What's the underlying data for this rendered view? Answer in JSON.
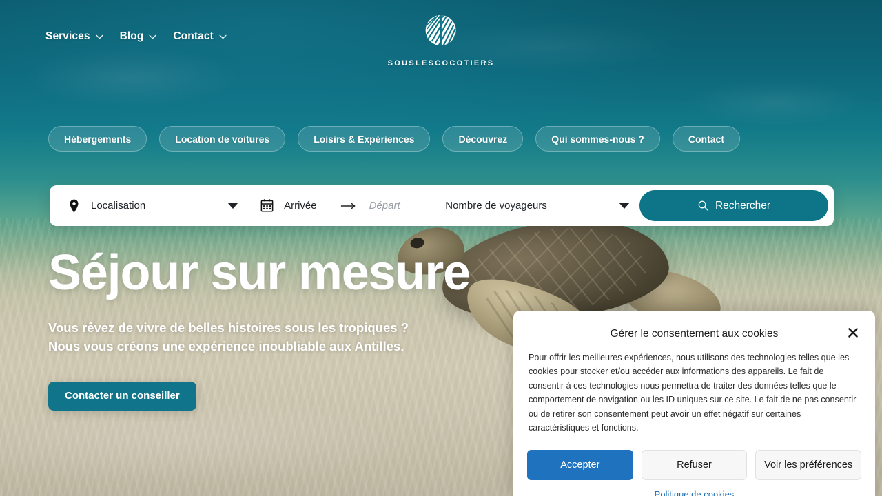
{
  "header": {
    "nav": [
      {
        "label": "Services",
        "icon": "chevron-down-icon"
      },
      {
        "label": "Blog",
        "icon": "chevron-down-icon"
      },
      {
        "label": "Contact",
        "icon": "chevron-down-icon"
      }
    ],
    "brand": {
      "name": "SOUSLESCOCOTIERS",
      "logo_icon": "palm-leaf-circle-logo"
    }
  },
  "categories": [
    {
      "label": "Hébergements"
    },
    {
      "label": "Location de voitures"
    },
    {
      "label": "Loisirs & Expériences"
    },
    {
      "label": "Découvrez"
    },
    {
      "label": "Qui sommes-nous ?"
    },
    {
      "label": "Contact"
    }
  ],
  "search": {
    "location": {
      "label": "Localisation",
      "icon": "map-pin-icon",
      "dropdown_icon": "caret-down-icon"
    },
    "arrival": {
      "label": "Arrivée",
      "icon": "calendar-icon"
    },
    "separator_icon": "arrow-right-icon",
    "departure": {
      "placeholder": "Départ"
    },
    "guests": {
      "label": "Nombre de voyageurs",
      "dropdown_icon": "caret-down-icon"
    },
    "submit": {
      "label": "Rechercher",
      "icon": "search-icon"
    }
  },
  "hero": {
    "title": "Séjour sur mesure",
    "subtitle_line1": "Vous rêvez de vivre de belles histoires sous les tropiques ?",
    "subtitle_line2": "Nous vous créons une expérience inoubliable aux Antilles.",
    "cta": "Contacter un conseiller"
  },
  "cookie_dialog": {
    "title": "Gérer le consentement aux cookies",
    "close_icon": "close-icon",
    "body": "Pour offrir les meilleures expériences, nous utilisons des technologies telles que les cookies pour stocker et/ou accéder aux informations des appareils. Le fait de consentir à ces technologies nous permettra de traiter des données telles que le comportement de navigation ou les ID uniques sur ce site. Le fait de ne pas consentir ou de retirer son consentement peut avoir un effet négatif sur certaines caractéristiques et fonctions.",
    "accept": "Accepter",
    "refuse": "Refuser",
    "preferences": "Voir les préférences",
    "policy_link": "Politique de cookies"
  },
  "colors": {
    "brand_teal": "#0e7487",
    "cta_teal": "#10758a",
    "accept_blue": "#1f73be",
    "link_blue": "#1f6fb8",
    "water_top": "#0d6a7e",
    "sand": "#d2ccb6"
  }
}
